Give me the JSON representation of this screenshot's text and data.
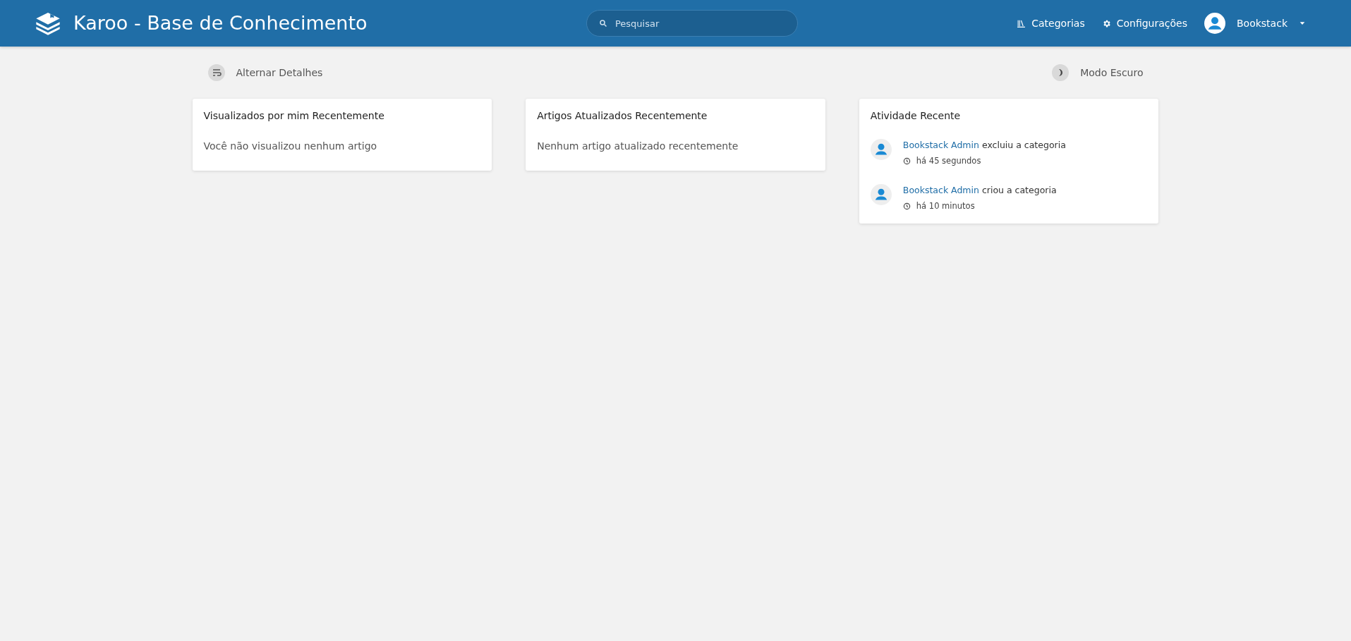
{
  "header": {
    "title": "Karoo - Base de Conhecimento",
    "search": {
      "placeholder": "Pesquisar"
    },
    "nav": [
      {
        "kind": "shelves",
        "label": "Categorias"
      },
      {
        "kind": "settings",
        "label": "Configurações"
      }
    ],
    "user": {
      "name": "Bookstack"
    }
  },
  "toolbar": {
    "left": {
      "label": "Alternar Detalhes"
    },
    "right": {
      "label": "Modo Escuro"
    }
  },
  "cards": [
    {
      "kind": "message",
      "title": "Visualizados por mim Recentemente",
      "message": "Você não visualizou nenhum artigo"
    },
    {
      "kind": "message",
      "title": "Artigos Atualizados Recentemente",
      "message": "Nenhum artigo atualizado recentemente"
    },
    {
      "kind": "activity",
      "title": "Atividade Recente",
      "items": [
        {
          "user": "Bookstack Admin",
          "action": "excluiu a categoria",
          "time": "há 45 segundos"
        },
        {
          "user": "Bookstack Admin",
          "action": "criou a categoria",
          "time": "há 10 minutos"
        }
      ]
    }
  ]
}
